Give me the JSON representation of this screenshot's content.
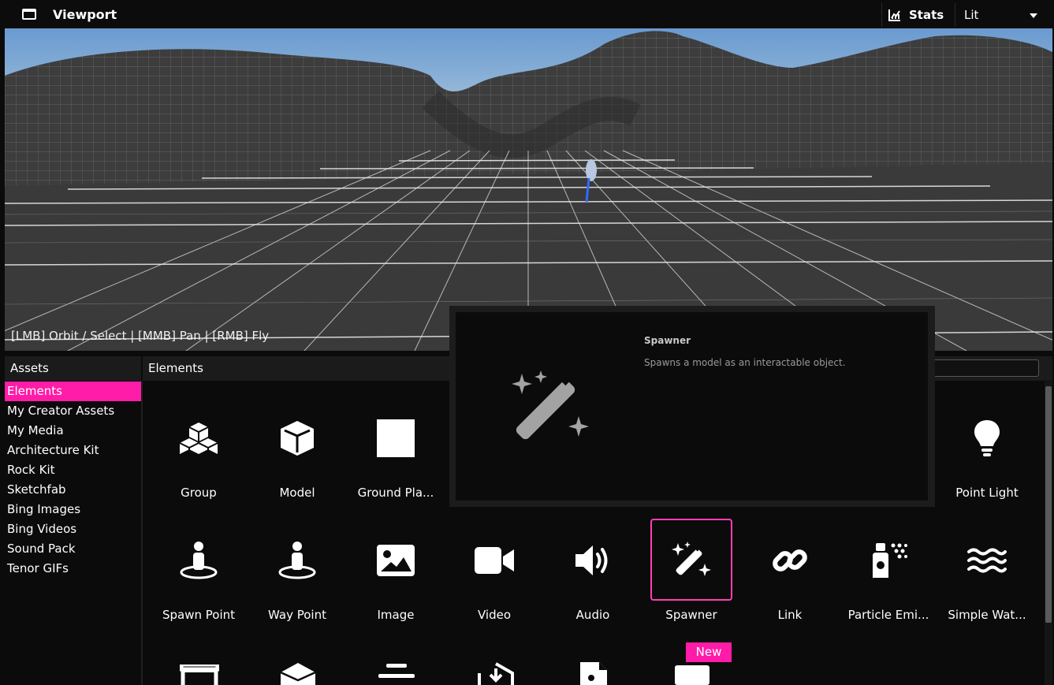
{
  "header": {
    "title": "Viewport",
    "stats_label": "Stats",
    "shading_mode": "Lit"
  },
  "viewport": {
    "controls_hint": "[LMB] Orbit / Select | [MMB] Pan | [RMB] Fly"
  },
  "assets": {
    "title": "Assets",
    "items": [
      {
        "label": "Elements",
        "active": true
      },
      {
        "label": "My Creator Assets"
      },
      {
        "label": "My Media"
      },
      {
        "label": "Architecture Kit"
      },
      {
        "label": "Rock Kit"
      },
      {
        "label": "Sketchfab"
      },
      {
        "label": "Bing Images"
      },
      {
        "label": "Bing Videos"
      },
      {
        "label": "Sound Pack"
      },
      {
        "label": "Tenor GIFs"
      }
    ]
  },
  "elements": {
    "title": "Elements",
    "search_placeholder": "",
    "tiles": [
      {
        "label": "Group",
        "icon": "cubes-icon"
      },
      {
        "label": "Model",
        "icon": "cube-icon"
      },
      {
        "label": "Ground Pla...",
        "icon": "square-icon"
      },
      {
        "label": "Point Light",
        "icon": "lightbulb-icon"
      },
      {
        "label": "Spawn Point",
        "icon": "spawn-point-icon"
      },
      {
        "label": "Way Point",
        "icon": "way-point-icon"
      },
      {
        "label": "Image",
        "icon": "image-icon"
      },
      {
        "label": "Video",
        "icon": "video-camera-icon"
      },
      {
        "label": "Audio",
        "icon": "speaker-icon"
      },
      {
        "label": "Spawner",
        "icon": "magic-wand-icon",
        "selected": true
      },
      {
        "label": "Link",
        "icon": "link-icon"
      },
      {
        "label": "Particle Emi...",
        "icon": "spray-can-icon"
      },
      {
        "label": "Simple Wat...",
        "icon": "water-icon"
      }
    ],
    "new_badge": "New"
  },
  "tooltip": {
    "title": "Spawner",
    "description": "Spawns a model as an interactable object.",
    "icon": "magic-wand-icon"
  },
  "colors": {
    "accent": "#ff1ca8",
    "background": "#0b0b0b"
  }
}
